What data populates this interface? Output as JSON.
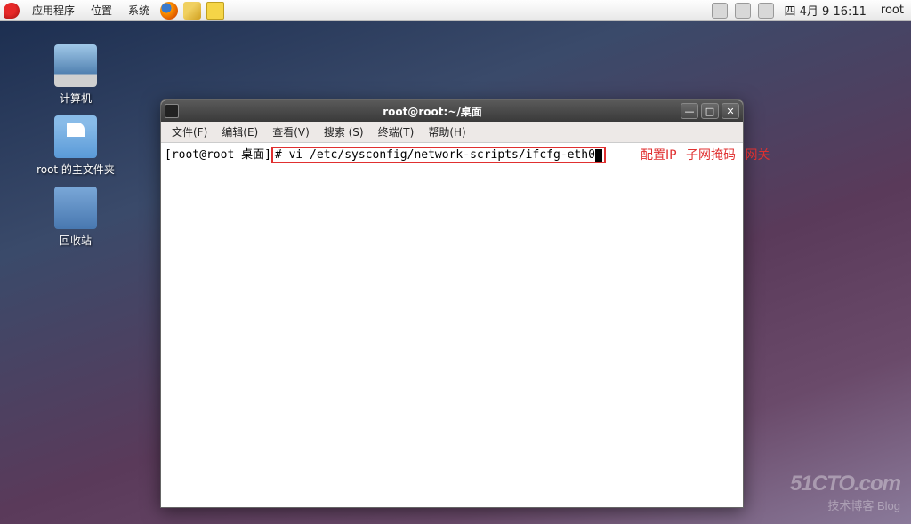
{
  "panel": {
    "menus": {
      "applications": "应用程序",
      "places": "位置",
      "system": "系统"
    },
    "datetime": "四 4月  9 16:11",
    "user": "root"
  },
  "desktop": {
    "computer": "计算机",
    "home": "root 的主文件夹",
    "trash": "回收站"
  },
  "terminal": {
    "title": "root@root:~/桌面",
    "menus": {
      "file": "文件(F)",
      "edit": "编辑(E)",
      "view": "查看(V)",
      "search": "搜索 (S)",
      "terminal": "终端(T)",
      "help": "帮助(H)"
    },
    "prompt": "[root@root 桌面]",
    "command": "# vi /etc/sysconfig/network-scripts/ifcfg-eth0",
    "window_controls": {
      "minimize": "—",
      "maximize": "□",
      "close": "✕"
    }
  },
  "annotation": {
    "part1": "配置IP",
    "part2": "子网掩码",
    "part3": "网关"
  },
  "watermark": {
    "site": "51CTO.com",
    "tagline": "技术博客",
    "blog": "Blog"
  }
}
